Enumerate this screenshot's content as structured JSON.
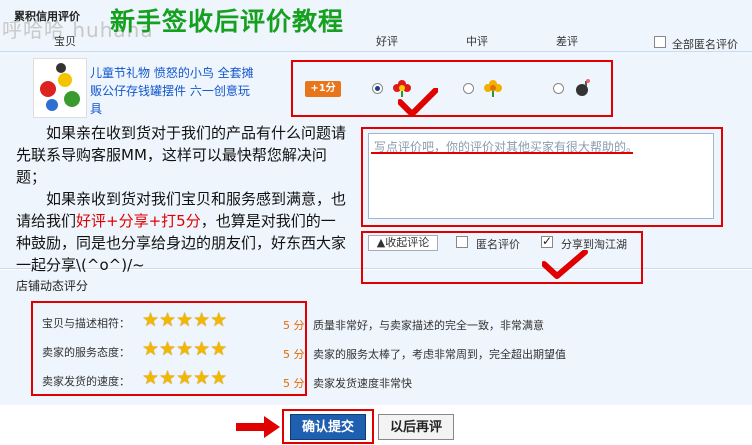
{
  "watermark": "呼哈哈 huhaha",
  "tutorial_title": "新手签收后评价教程",
  "header": {
    "section_label": "累积信用评价",
    "col_item": "宝贝",
    "col_good": "好评",
    "col_neutral": "中评",
    "col_bad": "差评",
    "all_anonymous": "全部匿名评价"
  },
  "product": {
    "name": "儿童节礼物 愤怒的小鸟 全套摊贩公仔存钱罐摆件 六一创意玩具"
  },
  "rating": {
    "points_badge": "+1分",
    "selected": "好评"
  },
  "message": {
    "part1": "如果亲在收到货对于我们的产品有什么问题请先联系导购客服MM，这样可以最快帮您解决问题；",
    "part2_before": "如果亲收到货对我们宝贝和服务感到满意，也请给我们",
    "part2_highlight": "好评+分享+打5分",
    "part2_after": "，也算是对我们的一种鼓励，同是也分享给身边的朋友们，好东西大家一起分享\\(^o^)/~"
  },
  "review": {
    "placeholder": "写点评价吧，你的评价对其他买家有很大帮助的。",
    "collapse_label": "▲收起评论",
    "anonymous_label": "匿名评价",
    "share_label": "分享到淘江湖",
    "anonymous_checked": false,
    "share_checked": true
  },
  "shop_rating": {
    "title": "店铺动态评分",
    "rows": [
      {
        "label": "宝贝与描述相符：",
        "stars": 5,
        "score": "5 分",
        "desc": "质量非常好，与卖家描述的完全一致，非常满意"
      },
      {
        "label": "卖家的服务态度：",
        "stars": 5,
        "score": "5 分",
        "desc": "卖家的服务太棒了，考虑非常周到，完全超出期望值"
      },
      {
        "label": "卖家发货的速度：",
        "stars": 5,
        "score": "5 分",
        "desc": "卖家发货速度非常快"
      }
    ]
  },
  "buttons": {
    "confirm": "确认提交",
    "later": "以后再评"
  },
  "colors": {
    "accent_red": "#e00000",
    "title_green": "#15a020",
    "panel_bg": "#eef5fc",
    "confirm_blue": "#1f5fb0"
  }
}
